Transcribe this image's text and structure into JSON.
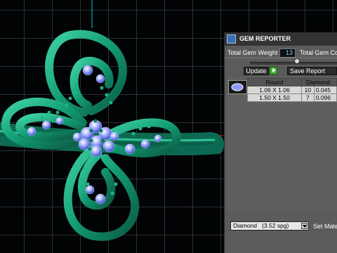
{
  "colors": {
    "metal": "#1a9a76",
    "gem": "#7788ff",
    "panel": "#5b5b5b",
    "title_bar": "#333333",
    "value_text": "#6fd0ff",
    "play": "#3cbd2f"
  },
  "panel": {
    "title": "GEM REPORTER",
    "total_weight_label": "Total Gem Weight",
    "total_weight_value": "13",
    "total_count_label": "Total Gem Co",
    "update_label": "Update",
    "save_label": "Save Report",
    "table": {
      "headers": [
        "Round",
        "Diamond"
      ],
      "rows": [
        {
          "size": "1.06 X 1.06",
          "count": "10",
          "weight": "0.045"
        },
        {
          "size": "1.50 X 1.50",
          "count": "7",
          "weight": "0.096"
        }
      ]
    },
    "material_value": "Diamond   (3.52 spg)",
    "set_material_label": "Set Mate"
  },
  "icons": [
    "app-icon",
    "play-icon",
    "dropdown-arrow-icon",
    "gem-thumbnail-icon"
  ]
}
